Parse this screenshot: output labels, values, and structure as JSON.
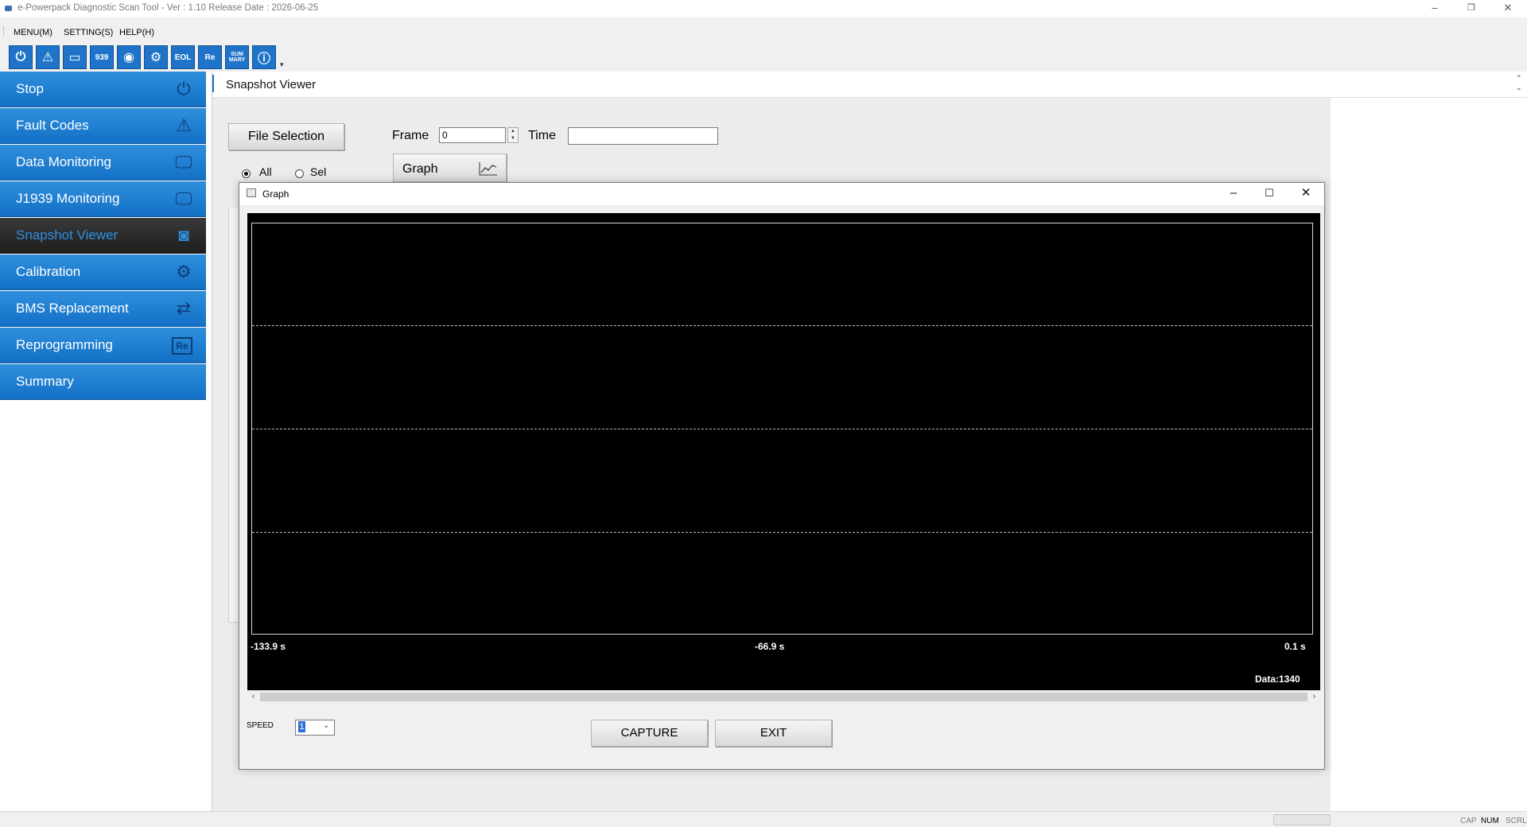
{
  "window": {
    "title": "e-Powerpack Diagnostic Scan Tool - Ver : 1.10 Release Date : 2026-06-25",
    "minimize_glyph": "–",
    "restore_glyph": "❐",
    "close_glyph": "✕"
  },
  "menu": [
    "MENU(M)",
    "SETTING(S)",
    "HELP(H)"
  ],
  "toolbar": {
    "buttons": [
      {
        "icon": "power-icon",
        "glyph": "⏻"
      },
      {
        "icon": "warning-icon",
        "glyph": "⚠"
      },
      {
        "icon": "monitor-icon",
        "glyph": "▭"
      },
      {
        "icon": "j1939-monitor-icon",
        "glyph": "939"
      },
      {
        "icon": "camera-icon",
        "glyph": "◉"
      },
      {
        "icon": "calibration-icon",
        "glyph": "⚙"
      },
      {
        "icon": "eol-icon",
        "glyph": "EOL"
      },
      {
        "icon": "reprogram-icon",
        "glyph": "Re"
      },
      {
        "icon": "summary-icon",
        "glyph": "SUM MARY"
      },
      {
        "icon": "info-icon",
        "glyph": "ⓘ"
      }
    ]
  },
  "sidebar": {
    "items": [
      {
        "label": "Stop",
        "icon": "power-icon",
        "glyph": "⏻"
      },
      {
        "label": "Fault Codes",
        "icon": "warning-icon",
        "glyph": "⚠"
      },
      {
        "label": "Data Monitoring",
        "icon": "monitor-icon",
        "glyph": "🖵"
      },
      {
        "label": "J1939 Monitoring",
        "icon": "monitor-icon",
        "glyph": "🖵"
      },
      {
        "label": "Snapshot Viewer",
        "icon": "camera-icon",
        "glyph": "◙",
        "active": true
      },
      {
        "label": "Calibration",
        "icon": "calibration-icon",
        "glyph": "⚙"
      },
      {
        "label": "BMS Replacement",
        "icon": "bms-replace-icon",
        "glyph": "⇄"
      },
      {
        "label": "Reprogramming",
        "icon": "reprogram-icon",
        "glyph": "Re"
      },
      {
        "label": "Summary",
        "icon": "",
        "glyph": ""
      }
    ]
  },
  "main": {
    "title": "Snapshot Viewer",
    "file_selection_label": "File Selection",
    "frame_label": "Frame",
    "frame_value": "0",
    "time_label": "Time",
    "time_value": "",
    "graph_label": "Graph",
    "radio_all": "All",
    "radio_sel": "Sel",
    "selected_radio": "All"
  },
  "graph_dialog": {
    "title": "Graph",
    "x_ticks": [
      "-133.9 s",
      "-66.9 s",
      "0.1 s"
    ],
    "data_count": "Data:1340",
    "speed_label": "SPEED",
    "speed_value": "1",
    "capture_label": "CAPTURE",
    "exit_label": "EXIT"
  },
  "chart_data": {
    "type": "line",
    "x_ticks": [
      "-133.9 s",
      "-66.9 s",
      "0.1 s"
    ],
    "xlim": [
      -133.9,
      0.1
    ],
    "series": [],
    "grid": true,
    "annotations": [
      "Data:1340"
    ],
    "background": "#000000"
  },
  "statusbar": {
    "keys": [
      {
        "label": "CAP",
        "on": false
      },
      {
        "label": "NUM",
        "on": true
      },
      {
        "label": "SCRL",
        "on": false
      }
    ]
  },
  "colors": {
    "accent": "#1f74c9",
    "active_item_bg": "#2a2a2a",
    "active_item_text": "#2e8fe0",
    "plot_bg": "#000000"
  }
}
